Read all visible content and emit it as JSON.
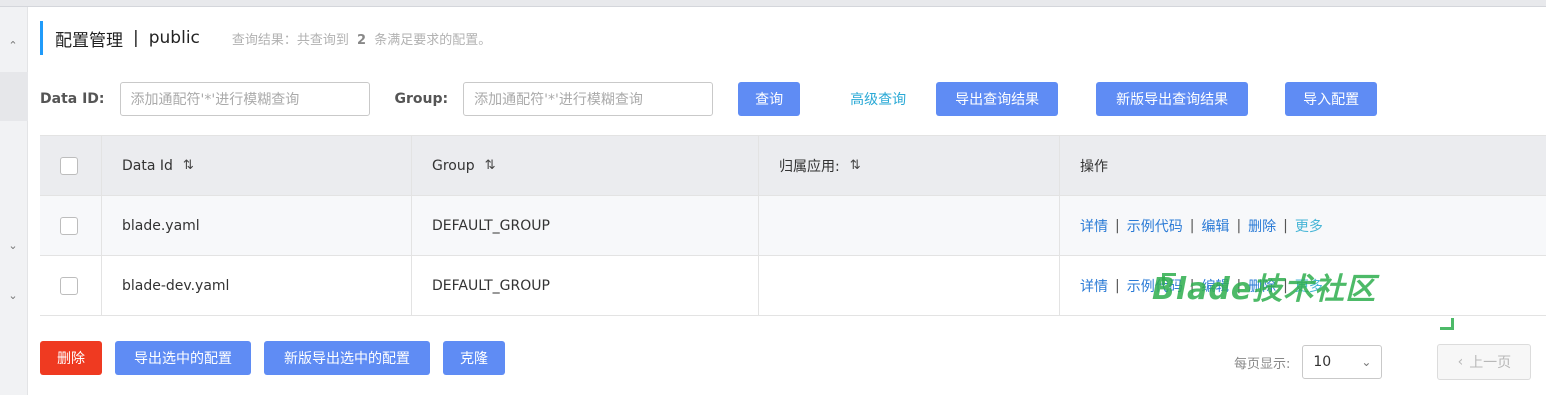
{
  "header": {
    "title": "配置管理",
    "separator": "|",
    "namespace": "public",
    "result_prefix": "查询结果：共查询到",
    "result_count": "2",
    "result_suffix": "条满足要求的配置。"
  },
  "filters": {
    "data_id_label": "Data ID:",
    "data_id_placeholder": "添加通配符'*'进行模糊查询",
    "group_label": "Group:",
    "group_placeholder": "添加通配符'*'进行模糊查询",
    "query_button": "查询",
    "advanced_query": "高级查询",
    "export_button": "导出查询结果",
    "new_export_button": "新版导出查询结果",
    "import_button": "导入配置"
  },
  "table": {
    "columns": [
      "Data Id",
      "Group",
      "归属应用:",
      "操作"
    ],
    "rows": [
      {
        "data_id": "blade.yaml",
        "group": "DEFAULT_GROUP",
        "app": ""
      },
      {
        "data_id": "blade-dev.yaml",
        "group": "DEFAULT_GROUP",
        "app": ""
      }
    ],
    "actions": [
      "详情",
      "示例代码",
      "编辑",
      "删除",
      "更多"
    ]
  },
  "bottom": {
    "delete_button": "删除",
    "export_selected_button": "导出选中的配置",
    "new_export_selected_button": "新版导出选中的配置",
    "clone_button": "克隆",
    "page_size_label": "每页显示:",
    "page_size_value": "10",
    "prev_button": "上一页"
  },
  "watermark": "Blade技术社区",
  "icons": {
    "sort": "sort-icon",
    "chevron_up": "chevron-up-icon",
    "chevron_down": "chevron-down-icon",
    "chevron_left": "chevron-left-icon"
  },
  "colors": {
    "primary": "#5f8cf4",
    "danger": "#ef3a21",
    "accent_bar": "#209bfa",
    "link": "#2b7bd6",
    "watermark": "#2fae4e"
  }
}
